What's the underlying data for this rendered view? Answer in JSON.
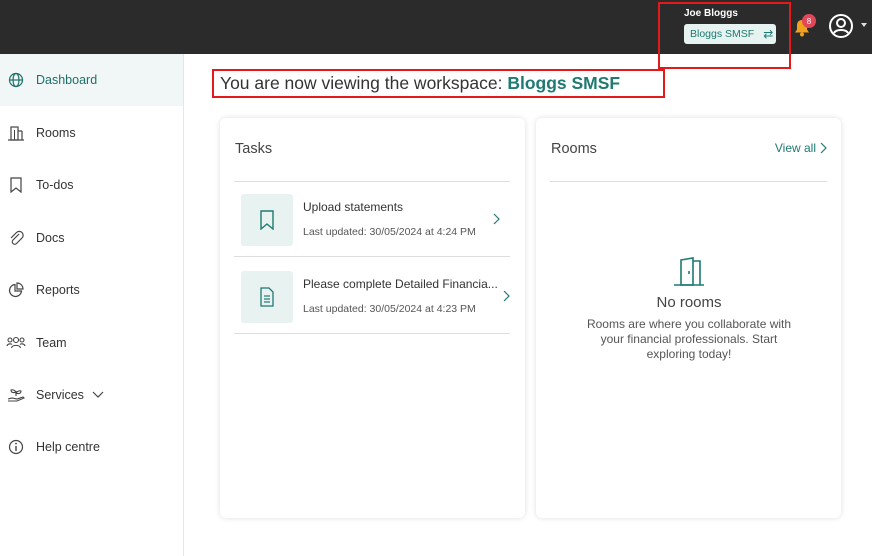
{
  "topbar": {
    "user_name": "Joe Bloggs",
    "workspace_chip": "Bloggs SMSF",
    "notification_count": "8"
  },
  "sidebar": {
    "items": [
      {
        "label": "Dashboard",
        "icon": "globe-icon"
      },
      {
        "label": "Rooms",
        "icon": "building-icon"
      },
      {
        "label": "To-dos",
        "icon": "bookmark-icon"
      },
      {
        "label": "Docs",
        "icon": "paperclip-icon"
      },
      {
        "label": "Reports",
        "icon": "pie-chart-icon"
      },
      {
        "label": "Team",
        "icon": "team-icon"
      },
      {
        "label": "Services",
        "icon": "hand-plant-icon"
      },
      {
        "label": "Help centre",
        "icon": "info-icon"
      }
    ]
  },
  "main": {
    "heading_prefix": "You are now viewing the workspace: ",
    "heading_workspace": "Bloggs SMSF"
  },
  "tasks": {
    "title": "Tasks",
    "items": [
      {
        "title": "Upload statements",
        "updated": "Last updated: 30/05/2024 at 4:24 PM",
        "icon": "bookmark-icon"
      },
      {
        "title": "Please complete Detailed Financia...",
        "updated": "Last updated: 30/05/2024 at 4:23 PM",
        "icon": "document-icon"
      }
    ]
  },
  "rooms": {
    "title": "Rooms",
    "view_all": "View all",
    "empty_title": "No rooms",
    "empty_text": "Rooms are where you collaborate with your financial professionals. Start exploring today!"
  },
  "colors": {
    "accent": "#1f7a72",
    "topbar": "#2b2b2b",
    "highlight": "#e31a1a",
    "badge": "#e0485a",
    "bell": "#f0a21c"
  }
}
